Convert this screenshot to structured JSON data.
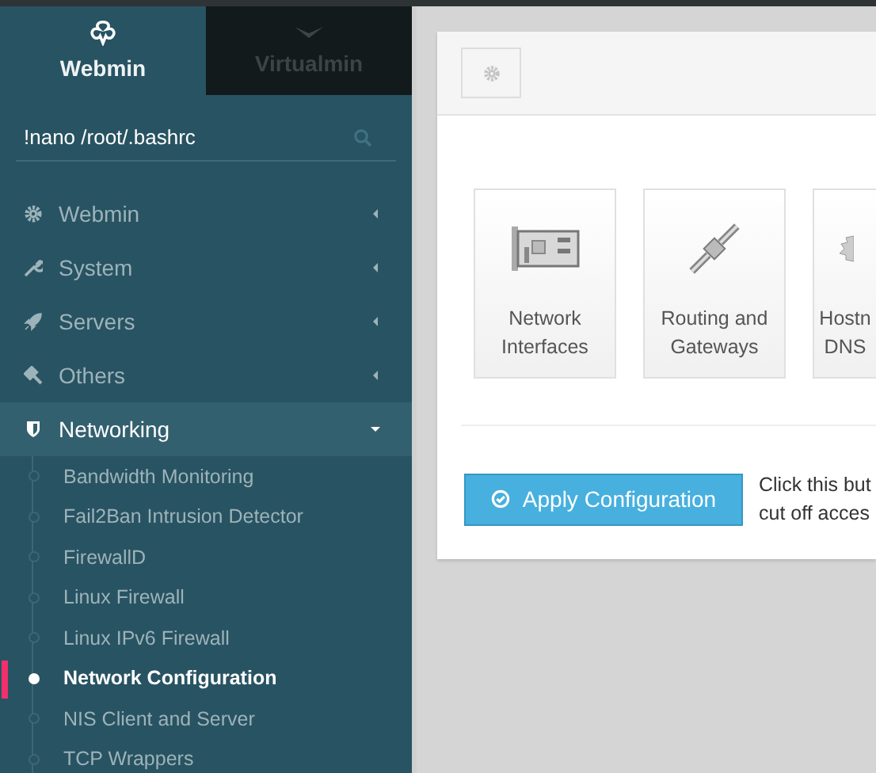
{
  "switcher": [
    {
      "label": "Webmin",
      "selected": true
    },
    {
      "label": "Virtualmin",
      "selected": false
    }
  ],
  "search": {
    "value": "!nano /root/.bashrc"
  },
  "menu": [
    {
      "label": "Webmin",
      "expanded": false
    },
    {
      "label": "System",
      "expanded": false
    },
    {
      "label": "Servers",
      "expanded": false
    },
    {
      "label": "Others",
      "expanded": false
    },
    {
      "label": "Networking",
      "expanded": true,
      "children": [
        {
          "label": "Bandwidth Monitoring",
          "selected": false
        },
        {
          "label": "Fail2Ban Intrusion Detector",
          "selected": false
        },
        {
          "label": "FirewallD",
          "selected": false
        },
        {
          "label": "Linux Firewall",
          "selected": false
        },
        {
          "label": "Linux IPv6 Firewall",
          "selected": false
        },
        {
          "label": "Network Configuration",
          "selected": true
        },
        {
          "label": "NIS Client and Server",
          "selected": false
        },
        {
          "label": "TCP Wrappers",
          "selected": false
        }
      ]
    }
  ],
  "tiles": [
    {
      "lines": [
        "Network",
        "Interfaces"
      ]
    },
    {
      "lines": [
        "Routing and",
        "Gateways"
      ]
    },
    {
      "lines": [
        "Hostn",
        "DNS"
      ]
    }
  ],
  "apply_button": {
    "label": "Apply Configuration"
  },
  "apply_note": [
    "Click this but",
    "cut off acces"
  ]
}
